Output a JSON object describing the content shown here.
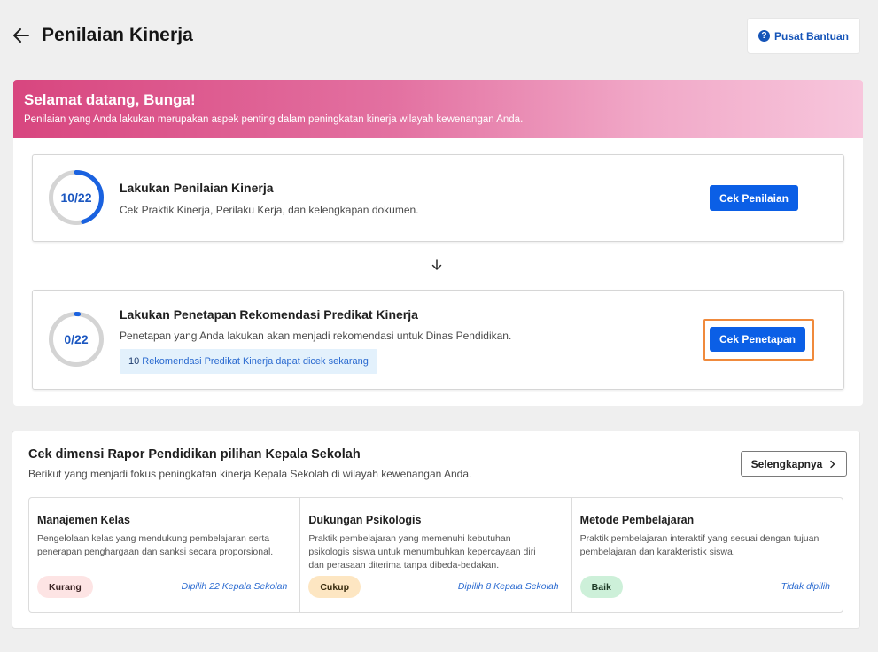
{
  "header": {
    "title": "Penilaian Kinerja",
    "help_label": "Pusat Bantuan",
    "help_icon": "question-circle-icon"
  },
  "banner": {
    "title": "Selamat datang, Bunga!",
    "subtitle": "Penilaian yang Anda lakukan merupakan aspek penting dalam peningkatan kinerja wilayah kewenangan Anda."
  },
  "tasks": [
    {
      "progress_label": "10/22",
      "progress": {
        "done": 10,
        "total": 22
      },
      "title": "Lakukan Penilaian Kinerja",
      "description": "Cek Praktik Kinerja, Perilaku Kerja, dan kelengkapan dokumen.",
      "button_label": "Cek Penilaian"
    },
    {
      "progress_label": "0/22",
      "progress": {
        "done": 0,
        "total": 22
      },
      "title": "Lakukan Penetapan Rekomendasi Predikat Kinerja",
      "description": "Penetapan yang Anda lakukan akan menjadi rekomendasi untuk Dinas Pendidikan.",
      "info_count": "10",
      "info_text": "Rekomendasi Predikat Kinerja dapat dicek sekarang",
      "button_label": "Cek Penetapan"
    }
  ],
  "rapor": {
    "title": "Cek dimensi Rapor Pendidikan pilihan Kepala Sekolah",
    "subtitle": "Berikut yang menjadi fokus peningkatan kinerja Kepala Sekolah di wilayah kewenangan Anda.",
    "more_label": "Selengkapnya",
    "dimensions": [
      {
        "title": "Manajemen Kelas",
        "description": "Pengelolaan kelas yang mendukung pembelajaran serta penerapan penghargaan dan sanksi secara proporsional.",
        "status": "Kurang",
        "chosen": "Dipilih 22 Kepala Sekolah"
      },
      {
        "title": "Dukungan Psikologis",
        "description": "Praktik pembelajaran yang memenuhi kebutuhan psikologis siswa untuk menumbuhkan kepercayaan diri dan perasaan diterima tanpa dibeda-bedakan.",
        "status": "Cukup",
        "chosen": "Dipilih 8 Kepala Sekolah"
      },
      {
        "title": "Metode Pembelajaran",
        "description": "Praktik pembelajaran interaktif yang sesuai dengan tujuan pembelajaran dan karakteristik siswa.",
        "status": "Baik",
        "chosen": "Tidak dipilih"
      }
    ]
  },
  "colors": {
    "primary": "#0b5fe6",
    "ring_progress": "#1a62e0",
    "ring_track": "#d4d4d4",
    "highlight": "#f08a3c",
    "banner_start": "#d8467f",
    "banner_end": "#f7c6dc"
  }
}
